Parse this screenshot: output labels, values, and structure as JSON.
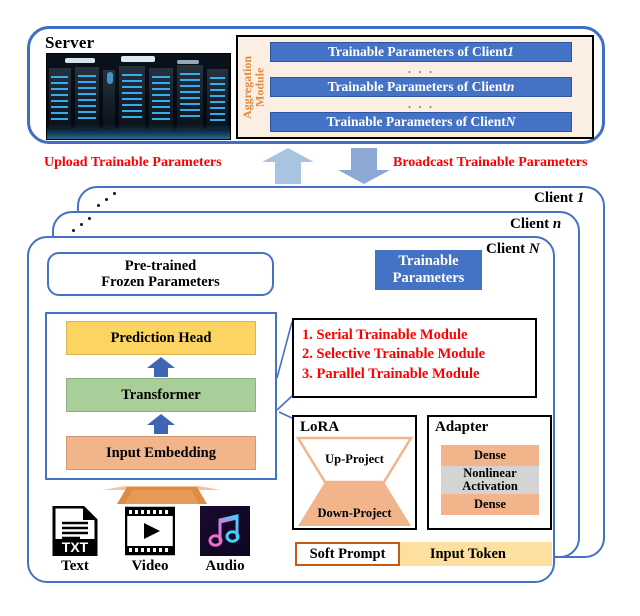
{
  "server": {
    "title": "Server",
    "photo_alt": "server-room-photo",
    "aggregation_label": "Aggregation Module",
    "client_params": [
      {
        "prefix": "Trainable Parameters of Client ",
        "index": "1"
      },
      {
        "prefix": "Trainable Parameters of Client ",
        "index": "n"
      },
      {
        "prefix": "Trainable Parameters of Client ",
        "index": "N"
      }
    ],
    "ellipsis": ". . ."
  },
  "transfer": {
    "upload_label": "Upload Trainable Parameters",
    "broadcast_label": "Broadcast Trainable Parameters",
    "upload_arrow_color": "#a8c4e0",
    "broadcast_arrow_color": "#8ba9d4",
    "label_color": "#ff0000"
  },
  "clients": {
    "tags": [
      "Client 1",
      "Client n",
      "Client N"
    ],
    "tag_prefix": "Client ",
    "tag_indices": [
      "1",
      "n",
      "N"
    ],
    "border_color": "#4472c4"
  },
  "client_detail": {
    "frozen_box": {
      "line1": "Pre-trained",
      "line2": "Frozen Parameters"
    },
    "trainable_badge": {
      "line1": "Trainable",
      "line2": "Parameters",
      "color": "#4472c4"
    },
    "stack": [
      {
        "label": "Prediction Head",
        "color": "#fcd462"
      },
      {
        "label": "Transformer",
        "color": "#a8cf9a"
      },
      {
        "label": "Input Embedding",
        "color": "#f2b48a"
      }
    ],
    "modalities": [
      {
        "label": "Text",
        "icon": "text-file-icon",
        "badge": "TXT"
      },
      {
        "label": "Video",
        "icon": "video-film-icon"
      },
      {
        "label": "Audio",
        "icon": "music-note-icon"
      }
    ],
    "modules": [
      "1. Serial Trainable Module",
      "2. Selective Trainable Module",
      "3. Parallel Trainable Module"
    ],
    "modules_color": "#ff0000",
    "lora": {
      "title": "LoRA",
      "up_project": "Up-Project",
      "down_project": "Down-Project",
      "fill_color": "#f2b48a"
    },
    "adapter": {
      "title": "Adapter",
      "rows": [
        {
          "label": "Dense",
          "color": "#f2b48a"
        },
        {
          "label": "Nonlinear Activation",
          "color": "#d4d4d4"
        },
        {
          "label": "Dense",
          "color": "#f2b48a"
        }
      ]
    },
    "prompt": {
      "soft_prompt": "Soft Prompt",
      "input_token": "Input Token",
      "soft_prompt_border": "#c55a11",
      "input_token_color": "#fde0a0"
    }
  }
}
